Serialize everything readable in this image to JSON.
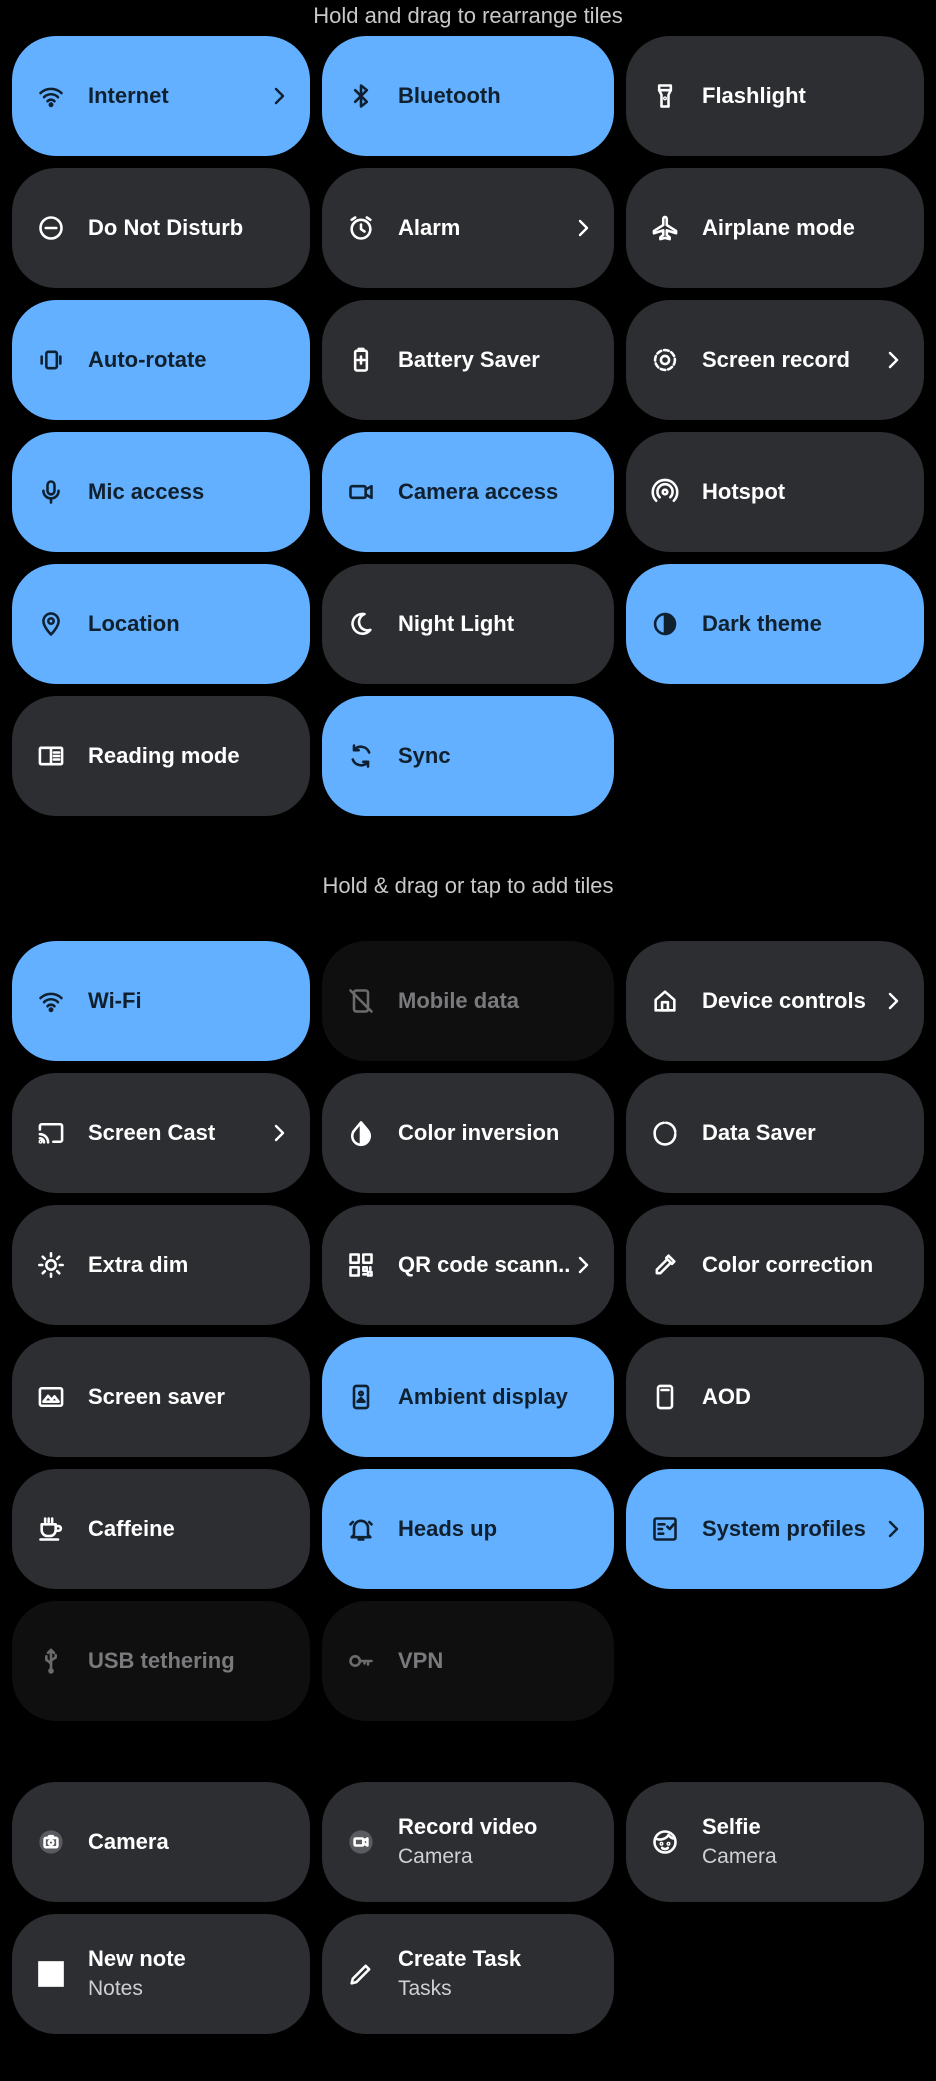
{
  "hints": {
    "top": "Hold and drag to rearrange tiles",
    "middle": "Hold & drag or tap to add tiles"
  },
  "colors": {
    "active_tile": "#62b0ff",
    "inactive_tile": "#2d2e32",
    "unavailable_tile": "#0f0f10",
    "background": "#000000"
  },
  "active_tiles": [
    {
      "label": "Internet",
      "icon": "wifi-icon",
      "state": "on",
      "chevron": true
    },
    {
      "label": "Bluetooth",
      "icon": "bluetooth-icon",
      "state": "on",
      "chevron": false
    },
    {
      "label": "Flashlight",
      "icon": "flashlight-icon",
      "state": "idle",
      "chevron": false
    },
    {
      "label": "Do Not Disturb",
      "icon": "do-not-disturb-icon",
      "state": "idle",
      "chevron": false
    },
    {
      "label": "Alarm",
      "icon": "alarm-icon",
      "state": "idle",
      "chevron": true
    },
    {
      "label": "Airplane mode",
      "icon": "airplane-icon",
      "state": "idle",
      "chevron": false
    },
    {
      "label": "Auto-rotate",
      "icon": "auto-rotate-icon",
      "state": "on",
      "chevron": false
    },
    {
      "label": "Battery Saver",
      "icon": "battery-saver-icon",
      "state": "idle",
      "chevron": false
    },
    {
      "label": "Screen record",
      "icon": "screen-record-icon",
      "state": "idle",
      "chevron": true
    },
    {
      "label": "Mic access",
      "icon": "microphone-icon",
      "state": "on",
      "chevron": false
    },
    {
      "label": "Camera access",
      "icon": "camera-access-icon",
      "state": "on",
      "chevron": false
    },
    {
      "label": "Hotspot",
      "icon": "hotspot-icon",
      "state": "idle",
      "chevron": false
    },
    {
      "label": "Location",
      "icon": "location-pin-icon",
      "state": "on",
      "chevron": false
    },
    {
      "label": "Night Light",
      "icon": "moon-icon",
      "state": "idle",
      "chevron": false
    },
    {
      "label": "Dark theme",
      "icon": "contrast-icon",
      "state": "on",
      "chevron": false
    },
    {
      "label": "Reading mode",
      "icon": "book-icon",
      "state": "idle",
      "chevron": false
    },
    {
      "label": "Sync",
      "icon": "sync-icon",
      "state": "on",
      "chevron": false
    }
  ],
  "available_tiles": [
    {
      "label": "Wi-Fi",
      "icon": "wifi-icon",
      "state": "on",
      "chevron": false
    },
    {
      "label": "Mobile data",
      "icon": "mobile-data-off-icon",
      "state": "off",
      "chevron": false
    },
    {
      "label": "Device controls",
      "icon": "home-icon",
      "state": "idle",
      "chevron": true
    },
    {
      "label": "Screen Cast",
      "icon": "cast-icon",
      "state": "idle",
      "chevron": true
    },
    {
      "label": "Color inversion",
      "icon": "color-inversion-icon",
      "state": "idle",
      "chevron": false
    },
    {
      "label": "Data Saver",
      "icon": "data-saver-icon",
      "state": "idle",
      "chevron": false
    },
    {
      "label": "Extra dim",
      "icon": "brightness-icon",
      "state": "idle",
      "chevron": false
    },
    {
      "label": "QR code scann..",
      "icon": "qr-code-icon",
      "state": "idle",
      "chevron": true
    },
    {
      "label": "Color correction",
      "icon": "eyedropper-icon",
      "state": "idle",
      "chevron": false
    },
    {
      "label": "Screen saver",
      "icon": "image-icon",
      "state": "idle",
      "chevron": false
    },
    {
      "label": "Ambient display",
      "icon": "ambient-display-icon",
      "state": "on",
      "chevron": false
    },
    {
      "label": "AOD",
      "icon": "phone-icon",
      "state": "idle",
      "chevron": false
    },
    {
      "label": "Caffeine",
      "icon": "coffee-cup-icon",
      "state": "idle",
      "chevron": false
    },
    {
      "label": "Heads up",
      "icon": "bell-icon",
      "state": "on",
      "chevron": false
    },
    {
      "label": "System profiles",
      "icon": "profiles-icon",
      "state": "on",
      "chevron": true
    },
    {
      "label": "USB tethering",
      "icon": "usb-icon",
      "state": "off",
      "chevron": false
    },
    {
      "label": "VPN",
      "icon": "key-icon",
      "state": "off",
      "chevron": false
    }
  ],
  "app_tiles": [
    {
      "label": "Camera",
      "sub": "",
      "icon": "camera-app-icon",
      "state": "idle",
      "chevron": false
    },
    {
      "label": "Record video",
      "sub": "Camera",
      "icon": "video-app-icon",
      "state": "idle",
      "chevron": false
    },
    {
      "label": "Selfie",
      "sub": "Camera",
      "icon": "selfie-icon",
      "state": "idle",
      "chevron": false
    },
    {
      "label": "New note",
      "sub": "Notes",
      "icon": "note-app-icon",
      "state": "idle",
      "chevron": false
    },
    {
      "label": "Create Task",
      "sub": "Tasks",
      "icon": "pencil-icon",
      "state": "idle",
      "chevron": false
    }
  ]
}
